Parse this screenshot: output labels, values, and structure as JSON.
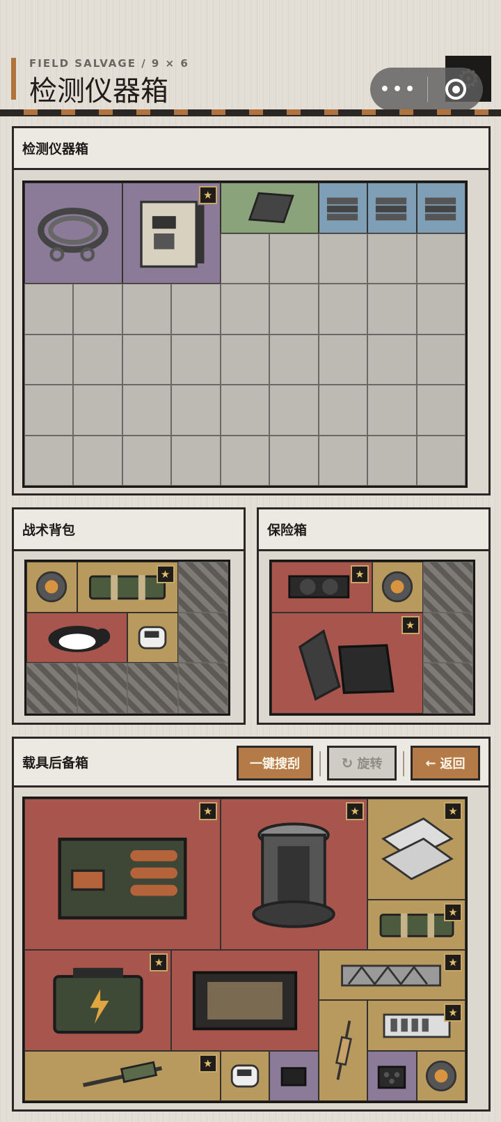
{
  "header": {
    "subtitle": "FIELD SALVAGE / 9 × 6",
    "title": "检测仪器箱",
    "menu_dots": "•••"
  },
  "colors": {
    "purple": "#8b7a98",
    "green": "#8aa37a",
    "blue": "#7f9fb7",
    "red": "#a8564d",
    "gold": "#b99a5e",
    "accent": "#b0733e"
  },
  "crate": {
    "title": "检测仪器箱",
    "grid_cols": 9,
    "grid_rows": 6,
    "items": [
      {
        "name": "steel-cable-coil",
        "icon": "cable-coil-icon",
        "rarity": "purple",
        "col": 0,
        "row": 0,
        "w": 2,
        "h": 2,
        "starred": false
      },
      {
        "name": "control-unit",
        "icon": "control-box-icon",
        "rarity": "purple",
        "col": 2,
        "row": 0,
        "w": 2,
        "h": 2,
        "starred": true
      },
      {
        "name": "tablet",
        "icon": "tablet-icon",
        "rarity": "green",
        "col": 4,
        "row": 0,
        "w": 2,
        "h": 1,
        "starred": false
      },
      {
        "name": "metal-plates",
        "icon": "metal-stack-icon",
        "rarity": "blue",
        "col": 6,
        "row": 0,
        "w": 1,
        "h": 1,
        "starred": false
      },
      {
        "name": "metal-plates",
        "icon": "metal-stack-icon",
        "rarity": "blue",
        "col": 7,
        "row": 0,
        "w": 1,
        "h": 1,
        "starred": false
      },
      {
        "name": "metal-plates",
        "icon": "metal-stack-icon",
        "rarity": "blue",
        "col": 8,
        "row": 0,
        "w": 1,
        "h": 1,
        "starred": false
      }
    ]
  },
  "backpack": {
    "title": "战术背包",
    "grid_cols": 4,
    "grid_rows": 3,
    "locked_cells": [
      [
        3,
        0
      ],
      [
        3,
        1
      ],
      [
        0,
        2
      ],
      [
        1,
        2
      ],
      [
        2,
        2
      ],
      [
        3,
        2
      ]
    ],
    "items": [
      {
        "name": "reactor-core-small",
        "icon": "core-icon",
        "rarity": "gold",
        "col": 0,
        "row": 0,
        "w": 1,
        "h": 1,
        "starred": false
      },
      {
        "name": "military-case",
        "icon": "case-icon",
        "rarity": "gold",
        "col": 1,
        "row": 0,
        "w": 2,
        "h": 1,
        "starred": true
      },
      {
        "name": "penguin-doll",
        "icon": "penguin-icon",
        "rarity": "red",
        "col": 0,
        "row": 1,
        "w": 2,
        "h": 1,
        "starred": false
      },
      {
        "name": "pulse-oximeter",
        "icon": "oximeter-icon",
        "rarity": "gold",
        "col": 2,
        "row": 1,
        "w": 1,
        "h": 1,
        "starred": false
      }
    ]
  },
  "safe": {
    "title": "保险箱",
    "grid_cols": 4,
    "grid_rows": 3,
    "locked_cells": [
      [
        3,
        0
      ],
      [
        3,
        1
      ],
      [
        3,
        2
      ]
    ],
    "items": [
      {
        "name": "graphics-card",
        "icon": "gpu-icon",
        "rarity": "red",
        "col": 0,
        "row": 0,
        "w": 2,
        "h": 1,
        "starred": true
      },
      {
        "name": "reactor-core-small",
        "icon": "core-icon",
        "rarity": "gold",
        "col": 2,
        "row": 0,
        "w": 1,
        "h": 1,
        "starred": false
      },
      {
        "name": "rugged-laptop",
        "icon": "laptop-icon",
        "rarity": "red",
        "col": 0,
        "row": 1,
        "w": 3,
        "h": 2,
        "starred": true
      }
    ]
  },
  "trunk": {
    "title": "载具后备箱",
    "btn_search": "一键搜刮",
    "btn_rotate": "旋转",
    "btn_back": "返回",
    "grid_cols": 9,
    "grid_rows": 6,
    "items": [
      {
        "name": "battery-pack",
        "icon": "battery-pack-icon",
        "rarity": "red",
        "col": 0,
        "row": 0,
        "w": 4,
        "h": 3,
        "starred": true
      },
      {
        "name": "reactor-core",
        "icon": "reactor-icon",
        "rarity": "red",
        "col": 4,
        "row": 0,
        "w": 3,
        "h": 3,
        "starred": true
      },
      {
        "name": "ceramic-plates",
        "icon": "plates-icon",
        "rarity": "gold",
        "col": 7,
        "row": 0,
        "w": 2,
        "h": 2,
        "starred": true
      },
      {
        "name": "military-case",
        "icon": "case-icon",
        "rarity": "gold",
        "col": 7,
        "row": 2,
        "w": 2,
        "h": 1,
        "starred": true
      },
      {
        "name": "power-battery",
        "icon": "power-battery-icon",
        "rarity": "red",
        "col": 0,
        "row": 3,
        "w": 3,
        "h": 2,
        "starred": true
      },
      {
        "name": "hex-armor-block",
        "icon": "hex-block-icon",
        "rarity": "red",
        "col": 3,
        "row": 3,
        "w": 3,
        "h": 2,
        "starred": false
      },
      {
        "name": "truss-beam",
        "icon": "beam-icon",
        "rarity": "gold",
        "col": 6,
        "row": 3,
        "w": 3,
        "h": 1,
        "starred": true
      },
      {
        "name": "syringe",
        "icon": "syringe-icon",
        "rarity": "gold",
        "col": 6,
        "row": 4,
        "w": 1,
        "h": 2,
        "starred": false
      },
      {
        "name": "server-module",
        "icon": "server-icon",
        "rarity": "gold",
        "col": 7,
        "row": 4,
        "w": 2,
        "h": 1,
        "starred": true
      },
      {
        "name": "hydraulic-piston",
        "icon": "piston-icon",
        "rarity": "gold",
        "col": 0,
        "row": 5,
        "w": 4,
        "h": 1,
        "starred": true
      },
      {
        "name": "pulse-oximeter",
        "icon": "oximeter-icon",
        "rarity": "gold",
        "col": 4,
        "row": 5,
        "w": 1,
        "h": 1,
        "starred": false
      },
      {
        "name": "mini-pc",
        "icon": "mini-pc-icon",
        "rarity": "purple",
        "col": 5,
        "row": 5,
        "w": 1,
        "h": 1,
        "starred": false
      },
      {
        "name": "ammo-crate",
        "icon": "ammo-crate-icon",
        "rarity": "purple",
        "col": 7,
        "row": 5,
        "w": 1,
        "h": 1,
        "starred": false
      },
      {
        "name": "reactor-core-small",
        "icon": "core-icon",
        "rarity": "gold",
        "col": 8,
        "row": 5,
        "w": 1,
        "h": 1,
        "starred": false
      }
    ]
  }
}
